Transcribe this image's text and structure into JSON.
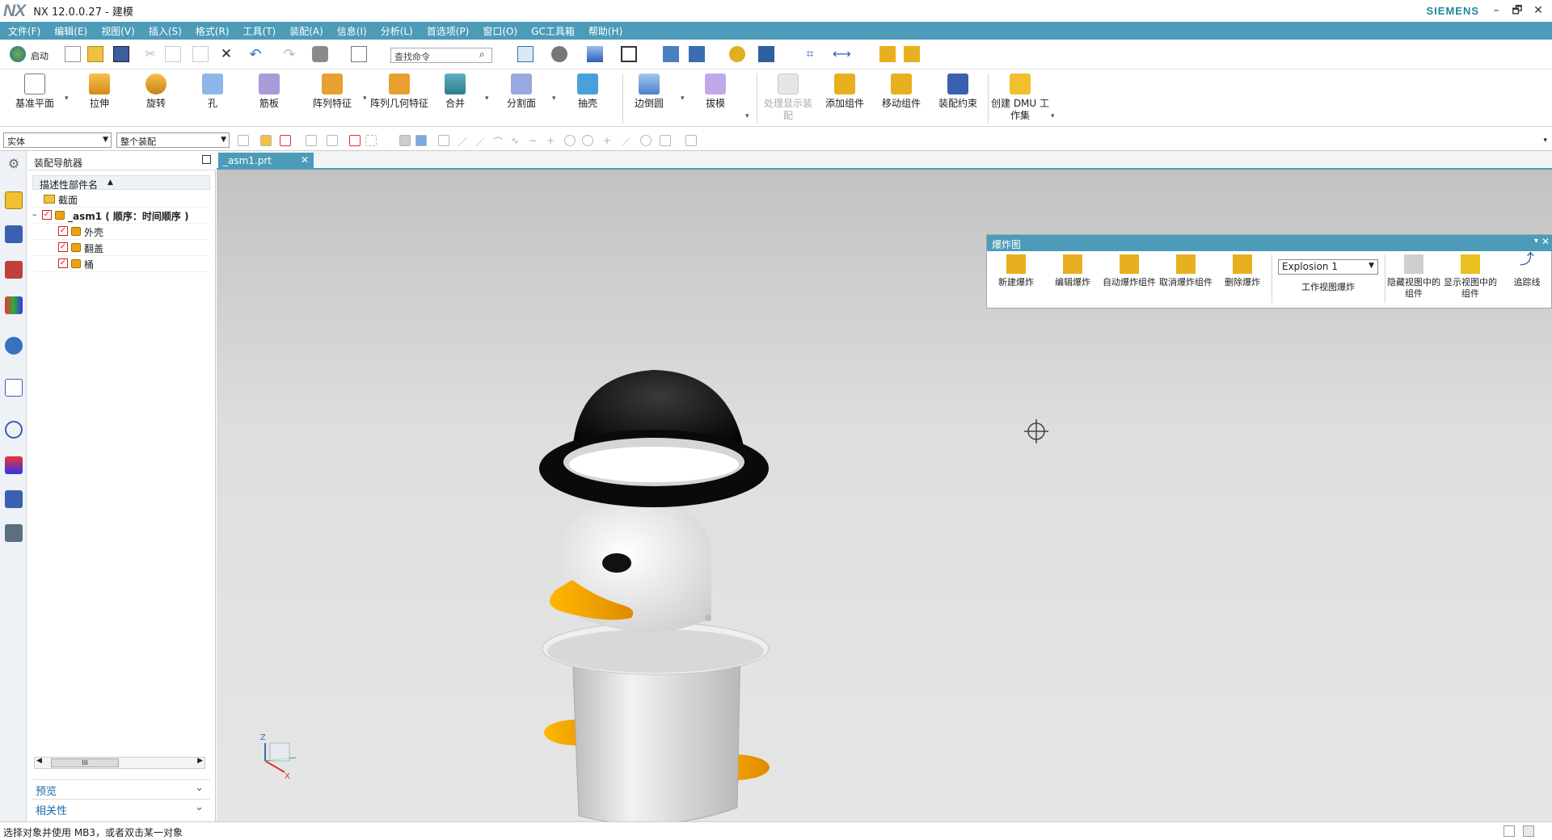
{
  "titlebar": {
    "logo": "NX",
    "title": "NX 12.0.0.27 - 建模",
    "brand": "SIEMENS",
    "minimize": "–",
    "restore": "🗗",
    "close": "✕"
  },
  "menu": [
    "文件(F)",
    "编辑(E)",
    "视图(V)",
    "插入(S)",
    "格式(R)",
    "工具(T)",
    "装配(A)",
    "信息(I)",
    "分析(L)",
    "首选项(P)",
    "窗口(O)",
    "GC工具箱",
    "帮助(H)"
  ],
  "quick": {
    "start_label": "启动",
    "find_placeholder": "查找命令"
  },
  "ribbon": {
    "datum_plane": "基准平面",
    "extrude": "拉伸",
    "revolve": "旋转",
    "hole": "孔",
    "rib": "筋板",
    "pattern_feature": "阵列特征",
    "pattern_geometry": "阵列几何特征",
    "unite": "合并",
    "split_face": "分割面",
    "shell": "抽壳",
    "edge_blend": "边倒圆",
    "draft": "拔模",
    "process_display": "处理显示装配",
    "add_component": "添加组件",
    "move_component": "移动组件",
    "assembly_constraint": "装配约束",
    "create_dmu": "创建 DMU 工作集"
  },
  "selection": {
    "filter": "实体",
    "scope": "整个装配"
  },
  "navigator": {
    "title": "装配导航器",
    "column_header": "描述性部件名",
    "rows": [
      {
        "label": "截面"
      },
      {
        "label": "_asm1 ( 顺序：时间顺序 )"
      },
      {
        "label": "外壳"
      },
      {
        "label": "翻盖"
      },
      {
        "label": "桶"
      }
    ],
    "scroll_thumb": "III",
    "sections": [
      "预览",
      "相关性"
    ]
  },
  "doc_tab": {
    "label": "_asm1.prt"
  },
  "explosion": {
    "title": "爆炸图",
    "buttons": [
      "新建爆炸",
      "编辑爆炸",
      "自动爆炸组件",
      "取消爆炸组件",
      "删除爆炸"
    ],
    "work_view_label": "工作视图爆炸",
    "selected": "Explosion 1",
    "buttons2": [
      "隐藏视图中的组件",
      "显示视图中的组件",
      "追踪线"
    ]
  },
  "triad": {
    "z": "Z",
    "x": "X"
  },
  "status": {
    "message": "选择对象并使用 MB3，或者双击某一对象"
  },
  "colors": {
    "accent": "#4c9bb8",
    "lid": "#0a0a0a",
    "beak": "#f5a300",
    "bin": "#e4e4e4"
  }
}
